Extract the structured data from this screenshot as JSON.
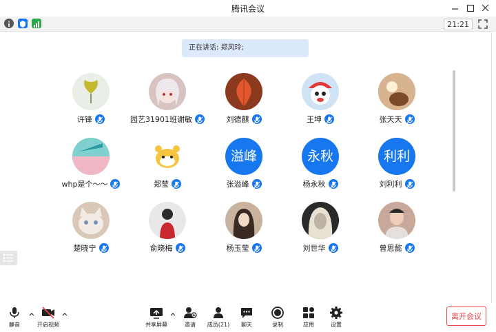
{
  "window": {
    "title": "腾讯会议"
  },
  "status": {
    "time": "21:21"
  },
  "speaking": {
    "text": "正在讲话: 郑风玲;"
  },
  "participants": [
    {
      "name": "许锋",
      "avatar": "ginkgo-leaf",
      "bg": "#e9efe6"
    },
    {
      "name": "园艺31901班谢敏",
      "avatar": "anime-girl",
      "bg": "#d8c3c0"
    },
    {
      "name": "刘德麒",
      "avatar": "red-leaf",
      "bg": "#8b3a1f"
    },
    {
      "name": "王坤",
      "avatar": "cartoon-character",
      "bg": "#cfe3f5"
    },
    {
      "name": "张天天",
      "avatar": "deer-photo",
      "bg": "#b59073"
    },
    {
      "name": "whp是个～～",
      "avatar": "sky-photo",
      "bg": "#8ec9cf"
    },
    {
      "name": "郑莹",
      "avatar": "cartoon-tiger",
      "bg": "#ffffff"
    },
    {
      "name": "张溢峰",
      "avatar_text": "溢峰"
    },
    {
      "name": "杨永秋",
      "avatar_text": "永秋"
    },
    {
      "name": "刘利利",
      "avatar_text": "利利"
    },
    {
      "name": "楚晓宁",
      "avatar": "cat-photo",
      "bg": "#d9c8b8"
    },
    {
      "name": "俞晓梅",
      "avatar": "girl-photo",
      "bg": "#e8e8e8"
    },
    {
      "name": "杨玉莹",
      "avatar": "girl-illustration",
      "bg": "#c9b39f"
    },
    {
      "name": "刘世华",
      "avatar": "blonde-portrait",
      "bg": "#2a2a2a"
    },
    {
      "name": "曾思懿",
      "avatar": "boy-photo",
      "bg": "#c7a99b"
    }
  ],
  "toolbar": {
    "mute": "静音",
    "video": "开启视频",
    "share": "共享屏幕",
    "invite": "邀请",
    "members": "成员(21)",
    "chat": "聊天",
    "record": "录制",
    "apps": "应用",
    "settings": "设置",
    "leave": "离开会议"
  },
  "colors": {
    "accent": "#1677ee",
    "leave": "#e7434a",
    "speaking_bg": "#dce9fb"
  }
}
